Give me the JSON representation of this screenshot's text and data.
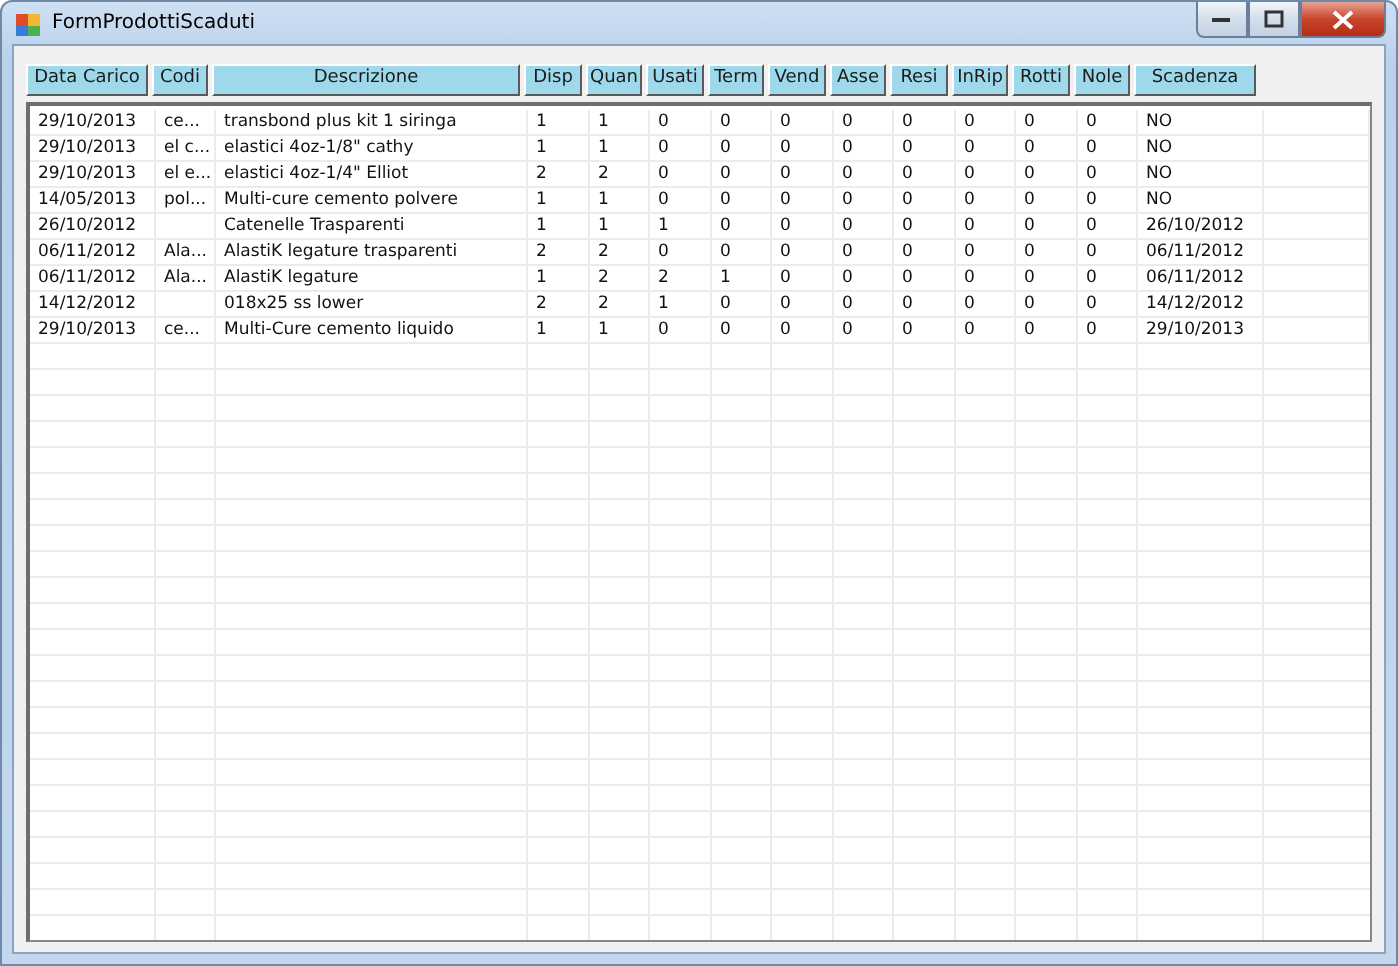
{
  "window": {
    "title": "FormProdottiScaduti"
  },
  "table": {
    "columns": [
      "Data Carico",
      "Codi",
      "Descrizione",
      "Disp",
      "Quan",
      "Usati",
      "Term",
      "Vend",
      "Asse",
      "Resi",
      "InRip",
      "Rotti",
      "Nole",
      "Scadenza"
    ],
    "rows": [
      [
        "29/10/2013",
        "ce...",
        "transbond plus kit 1 siringa",
        "1",
        "1",
        "0",
        "0",
        "0",
        "0",
        "0",
        "0",
        "0",
        "0",
        "NO"
      ],
      [
        "29/10/2013",
        "el c...",
        "elastici 4oz-1/8\" cathy",
        "1",
        "1",
        "0",
        "0",
        "0",
        "0",
        "0",
        "0",
        "0",
        "0",
        "NO"
      ],
      [
        "29/10/2013",
        "el e...",
        "elastici 4oz-1/4\" Elliot",
        "2",
        "2",
        "0",
        "0",
        "0",
        "0",
        "0",
        "0",
        "0",
        "0",
        "NO"
      ],
      [
        "14/05/2013",
        "pol...",
        "Multi-cure cemento polvere",
        "1",
        "1",
        "0",
        "0",
        "0",
        "0",
        "0",
        "0",
        "0",
        "0",
        "NO"
      ],
      [
        "26/10/2012",
        null,
        "Catenelle Trasparenti",
        "1",
        "1",
        "1",
        "0",
        "0",
        "0",
        "0",
        "0",
        "0",
        "0",
        "26/10/2012"
      ],
      [
        "06/11/2012",
        "Ala...",
        "AlastiK legature trasparenti",
        "2",
        "2",
        "0",
        "0",
        "0",
        "0",
        "0",
        "0",
        "0",
        "0",
        "06/11/2012"
      ],
      [
        "06/11/2012",
        "Ala...",
        "AlastiK legature",
        "1",
        "2",
        "2",
        "1",
        "0",
        "0",
        "0",
        "0",
        "0",
        "0",
        "06/11/2012"
      ],
      [
        "14/12/2012",
        null,
        "018x25 ss lower",
        "2",
        "2",
        "1",
        "0",
        "0",
        "0",
        "0",
        "0",
        "0",
        "0",
        "14/12/2012"
      ],
      [
        "29/10/2013",
        "ce...",
        "Multi-Cure cemento liquido",
        "1",
        "1",
        "0",
        "0",
        "0",
        "0",
        "0",
        "0",
        "0",
        "0",
        "29/10/2013"
      ]
    ]
  }
}
